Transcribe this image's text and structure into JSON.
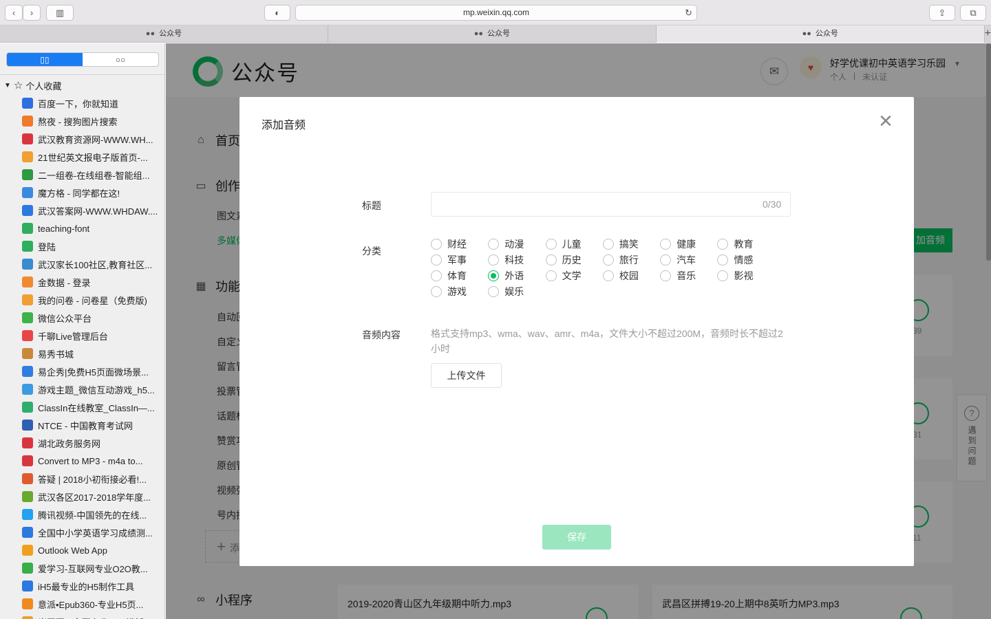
{
  "browser": {
    "url": "mp.weixin.qq.com",
    "tabs": [
      {
        "label": "公众号",
        "active": false
      },
      {
        "label": "公众号",
        "active": true
      },
      {
        "label": "公众号",
        "active": false
      }
    ]
  },
  "sidebar": {
    "folder_label": "个人收藏",
    "bookmarks": [
      {
        "label": "百度一下，你就知道",
        "icon": "baidu-icon",
        "color": "#2f6fe0"
      },
      {
        "label": "熬夜 - 搜狗图片搜索",
        "icon": "sogou-icon",
        "color": "#f07a29"
      },
      {
        "label": "武汉教育资源网-WWW.WH...",
        "icon": "sail-icon",
        "color": "#d8363f"
      },
      {
        "label": "21世纪英文报电子版首页-...",
        "icon": "star-icon",
        "color": "#f0a030"
      },
      {
        "label": "二一组卷-在线组卷-智能组...",
        "icon": "runner-icon",
        "color": "#2f9b3f"
      },
      {
        "label": "魔方格 - 同学都在这!",
        "icon": "owl-icon",
        "color": "#3a8be0"
      },
      {
        "label": "武汉答案网-WWW.WHDAW....",
        "icon": "globe-icon",
        "color": "#2a7ae0"
      },
      {
        "label": "teaching-font",
        "icon": "vue-icon",
        "color": "#2fae5e"
      },
      {
        "label": "登陆",
        "icon": "vue-icon",
        "color": "#2fae5e"
      },
      {
        "label": "武汉家长100社区,教育社区...",
        "icon": "bars-icon",
        "color": "#3a8bd0"
      },
      {
        "label": "金数据 - 登录",
        "icon": "puzzle-icon",
        "color": "#f08a30"
      },
      {
        "label": "我的问卷 - 问卷星（免费版)",
        "icon": "star-icon",
        "color": "#f0a030"
      },
      {
        "label": "微信公众平台",
        "icon": "wechat-icon",
        "color": "#3db34a"
      },
      {
        "label": "千聊Live管理后台",
        "icon": "chat-icon",
        "color": "#e8454a"
      },
      {
        "label": "易秀书城",
        "icon": "book-icon",
        "color": "#c8893a"
      },
      {
        "label": "易企秀|免费H5页面微场景...",
        "icon": "eqx-icon",
        "color": "#2f7de0"
      },
      {
        "label": "游戏主题_微信互动游戏_h5...",
        "icon": "plane-icon",
        "color": "#3a9be0"
      },
      {
        "label": "ClassIn在线教室_ClassIn—...",
        "icon": "classin-icon",
        "color": "#2fae6e"
      },
      {
        "label": "NTCE - 中国教育考试网",
        "icon": "ntce-icon",
        "color": "#2f5fb0"
      },
      {
        "label": "湖北政务服务网",
        "icon": "gov-icon",
        "color": "#d8363f"
      },
      {
        "label": "Convert to MP3 - m4a to...",
        "icon": "cloud-icon",
        "color": "#d8363f"
      },
      {
        "label": "答疑 | 2018小初衔接必看!...",
        "icon": "photo-icon",
        "color": "#e05a30"
      },
      {
        "label": "武汉各区2017-2018学年度...",
        "icon": "owl2-icon",
        "color": "#6aa830"
      },
      {
        "label": "腾讯视频-中国领先的在线...",
        "icon": "play-icon",
        "color": "#26a0f0"
      },
      {
        "label": "全国中小学英语学习成绩测...",
        "icon": "globe-icon",
        "color": "#2a7ae0"
      },
      {
        "label": "Outlook Web App",
        "icon": "outlook-icon",
        "color": "#f0a020"
      },
      {
        "label": "爱学习-互联网专业O2O教...",
        "icon": "leaf-icon",
        "color": "#3aae4a"
      },
      {
        "label": "iH5最专业的H5制作工具",
        "icon": "globe-icon",
        "color": "#2a7ae0"
      },
      {
        "label": "意派•Epub360-专业H5页...",
        "icon": "bitcoin-icon",
        "color": "#f08a20"
      },
      {
        "label": "当图图 - 全国专业PPT模板...",
        "icon": "ppt-icon",
        "color": "#e8a030"
      }
    ]
  },
  "page": {
    "logo_text": "公众号",
    "account": {
      "name": "好学优课初中英语学习乐园",
      "type": "个人",
      "status": "未认证"
    },
    "nav": {
      "home": "首页",
      "create": "创作",
      "create_items": [
        "图文素",
        "多媒体"
      ],
      "function": "功能",
      "function_items": [
        "自动回",
        "自定义",
        "留言管",
        "投票管",
        "话题标",
        "赞赏功",
        "原创管",
        "视频弹",
        "号内搜"
      ],
      "add": "添",
      "mini": "小程序"
    },
    "upload_audio_partial": "加音频",
    "card_numbers": [
      "89",
      "31",
      "11"
    ],
    "bottom_cards": [
      "2019-2020青山区九年级期中听力.mp3",
      "武昌区拼搏19-20上期中8英听力MP3.mp3"
    ],
    "help": "遇到问题"
  },
  "dialog": {
    "title": "添加音频",
    "title_label": "标题",
    "title_value": "",
    "title_counter": "0/30",
    "category_label": "分类",
    "categories": [
      {
        "label": "财经",
        "checked": false
      },
      {
        "label": "动漫",
        "checked": false
      },
      {
        "label": "儿童",
        "checked": false
      },
      {
        "label": "搞笑",
        "checked": false
      },
      {
        "label": "健康",
        "checked": false
      },
      {
        "label": "教育",
        "checked": false
      },
      {
        "label": "军事",
        "checked": false
      },
      {
        "label": "科技",
        "checked": false
      },
      {
        "label": "历史",
        "checked": false
      },
      {
        "label": "旅行",
        "checked": false
      },
      {
        "label": "汽车",
        "checked": false
      },
      {
        "label": "情感",
        "checked": false
      },
      {
        "label": "体育",
        "checked": false
      },
      {
        "label": "外语",
        "checked": true
      },
      {
        "label": "文学",
        "checked": false
      },
      {
        "label": "校园",
        "checked": false
      },
      {
        "label": "音乐",
        "checked": false
      },
      {
        "label": "影视",
        "checked": false
      },
      {
        "label": "游戏",
        "checked": false
      },
      {
        "label": "娱乐",
        "checked": false
      }
    ],
    "audio_label": "音频内容",
    "audio_hint": "格式支持mp3、wma、wav、amr、m4a，文件大小不超过200M，音频时长不超过2小时",
    "upload_label": "上传文件",
    "save_label": "保存"
  }
}
